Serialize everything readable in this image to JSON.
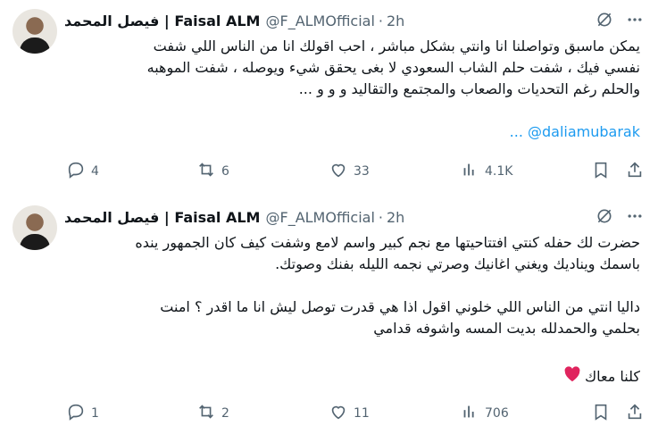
{
  "tweets": [
    {
      "author_name": "فيصل المحمد | Faisal ALM",
      "handle": "@F_ALMOfficial",
      "dot": "·",
      "time": "2h",
      "text": "يمكن ماسبق وتواصلنا انا وانتي بشكل مباشر ، احب اقولك انا من الناس اللي شفت\nنفسي فيك ، شفت حلم الشاب السعودي لا بغى يحقق شيء ويوصله ، شفت الموهبه\nوالحلم رغم التحديات والصعاب والمجتمع والتقاليد و و و ...",
      "mention": "@daliamubarak",
      "mention_prefix": "...",
      "replies": "4",
      "reposts": "6",
      "likes": "33",
      "views": "4.1K"
    },
    {
      "author_name": "فيصل المحمد | Faisal ALM",
      "handle": "@F_ALMOfficial",
      "dot": "·",
      "time": "2h",
      "text": "حضرت لك حفله كنتي افتتاحيتها مع نجم كبير واسم لامع وشفت كيف كان الجمهور ينده\nباسمك ويناديك ويغني اغانيك وصرتي نجمه الليله بفنك وصوتك.\n\nداليا انتي من الناس اللي خلوني اقول اذا هي قدرت توصل ليش انا ما اقدر ؟ امنت\nبحلمي والحمدلله بديت المسه واشوفه قدامي",
      "closing": "كلنا معاك",
      "replies": "1",
      "reposts": "2",
      "likes": "11",
      "views": "706"
    }
  ],
  "colors": {
    "accent": "#1d9bf0",
    "muted": "#536471",
    "text": "#0f1419",
    "heart": "#e0245e"
  },
  "icons": [
    "grok-icon",
    "more-icon",
    "reply-icon",
    "repost-icon",
    "like-icon",
    "views-icon",
    "bookmark-icon",
    "share-icon",
    "heart-emoji-icon"
  ]
}
